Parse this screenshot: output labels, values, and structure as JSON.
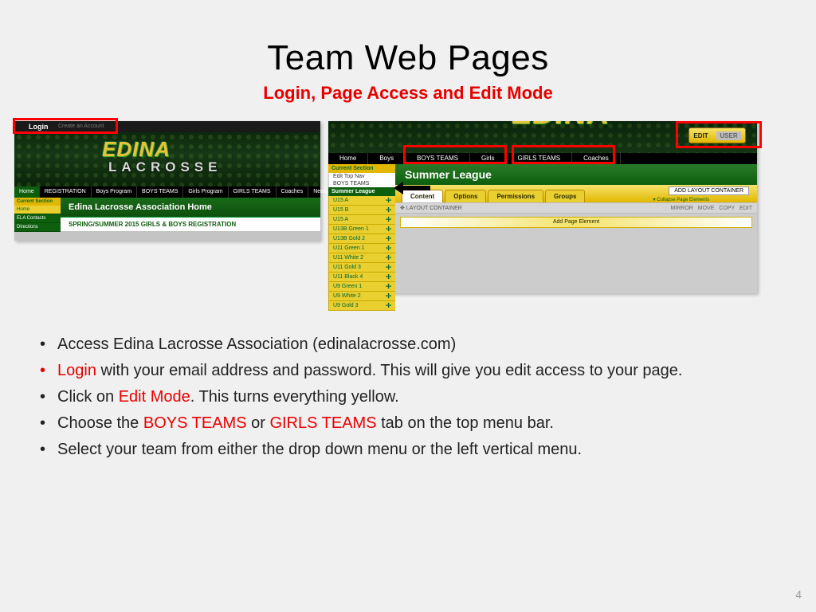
{
  "title": "Team Web Pages",
  "subtitle": "Login, Page Access and Edit Mode",
  "page_number": "4",
  "left_shot": {
    "login_label": "Login",
    "create_label": "Create an Account",
    "logo_line1": "EDINA",
    "logo_line2": "LACROSSE",
    "nav": [
      "Home",
      "REGISTRATION",
      "Boys Program",
      "BOYS TEAMS",
      "Girls Program",
      "GIRLS TEAMS",
      "Coaches",
      "News"
    ],
    "sidebar_header": "Current Section",
    "sidebar": [
      "Home",
      "ELA Contacts",
      "Directions"
    ],
    "page_title": "Edina Lacrosse Association Home",
    "reg_line": "SPRING/SUMMER 2015 GIRLS & BOYS REGISTRATION"
  },
  "right_shot": {
    "logo_line1": "EDINA",
    "edit_label": "EDIT",
    "edit_off": "USER",
    "nav": [
      "Home",
      "Boys",
      "BOYS TEAMS",
      "Girls",
      "GIRLS TEAMS",
      "Coaches"
    ],
    "sidebar_header": "Current Section",
    "edit_top_nav": "Edit Top Nav",
    "boys_teams_caption": "BOYS TEAMS",
    "section_label": "Summer League",
    "items": [
      "U15 A",
      "U15 B",
      "U15 A",
      "U13B Green 1",
      "U13B Gold 2",
      "U11 Green 1",
      "U11 White 2",
      "U11 Gold 3",
      "U11 Black 4",
      "U9 Green 1",
      "U9 White 2",
      "U9 Gold 3"
    ],
    "summer_league": "Summer League",
    "tabs": [
      "Content",
      "Options",
      "Permissions",
      "Groups"
    ],
    "add_layout": "ADD LAYOUT CONTAINER",
    "collapse": "▾ Collapse Page Elements",
    "layout_container": "✥ LAYOUT CONTAINER",
    "lc_actions": [
      "MIRROR",
      "MOVE",
      "COPY",
      "EDIT"
    ],
    "add_page_element": "Add Page Element"
  },
  "bullets": {
    "b1": "Access Edina Lacrosse Association (edinalacrosse.com)",
    "b2a": "Login",
    "b2b": " with your email address and password.  This will give you edit access to your page.",
    "b3a": "Click on ",
    "b3b": "Edit Mode",
    "b3c": ".  This turns everything yellow.",
    "b4a": "Choose the ",
    "b4b": "BOYS TEAMS",
    "b4c": " or ",
    "b4d": "GIRLS TEAMS",
    "b4e": " tab on the top menu bar.",
    "b5": "Select your team from either the drop down menu or the left vertical menu."
  }
}
